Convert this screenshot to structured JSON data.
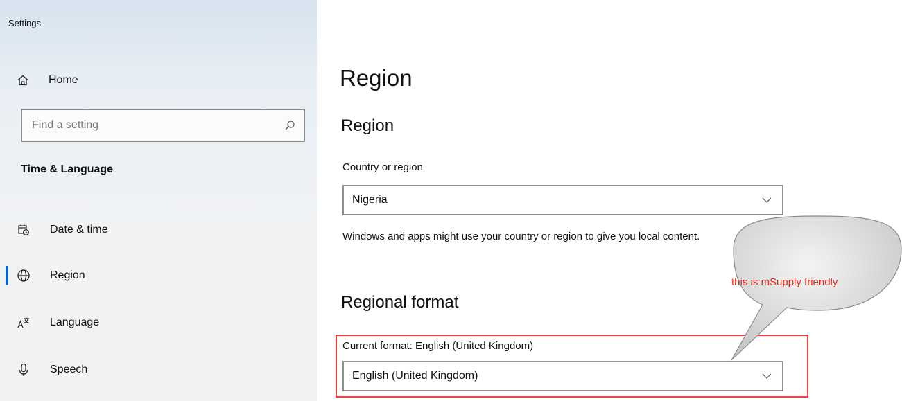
{
  "window": {
    "title": "Settings"
  },
  "sidebar": {
    "home": {
      "label": "Home",
      "icon": "home-icon"
    },
    "search": {
      "placeholder": "Find a setting",
      "icon": "search-icon"
    },
    "section_title": "Time & Language",
    "items": [
      {
        "label": "Date & time",
        "icon": "calendar-clock-icon",
        "active": false
      },
      {
        "label": "Region",
        "icon": "globe-icon",
        "active": true
      },
      {
        "label": "Language",
        "icon": "language-icon",
        "active": false
      },
      {
        "label": "Speech",
        "icon": "microphone-icon",
        "active": false
      }
    ]
  },
  "main": {
    "page_title": "Region",
    "region_section": {
      "heading": "Region",
      "country_label": "Country or region",
      "country_value": "Nigeria",
      "description": "Windows and apps might use your country or region to give you local content."
    },
    "format_section": {
      "heading": "Regional format",
      "current_label": "Current format: English (United Kingdom)",
      "format_value": "English (United Kingdom)"
    }
  },
  "annotation": {
    "text": "this is mSupply friendly",
    "color": "#e8453c"
  },
  "colors": {
    "accent": "#0a63c9",
    "annotation_red": "#e8453c"
  }
}
